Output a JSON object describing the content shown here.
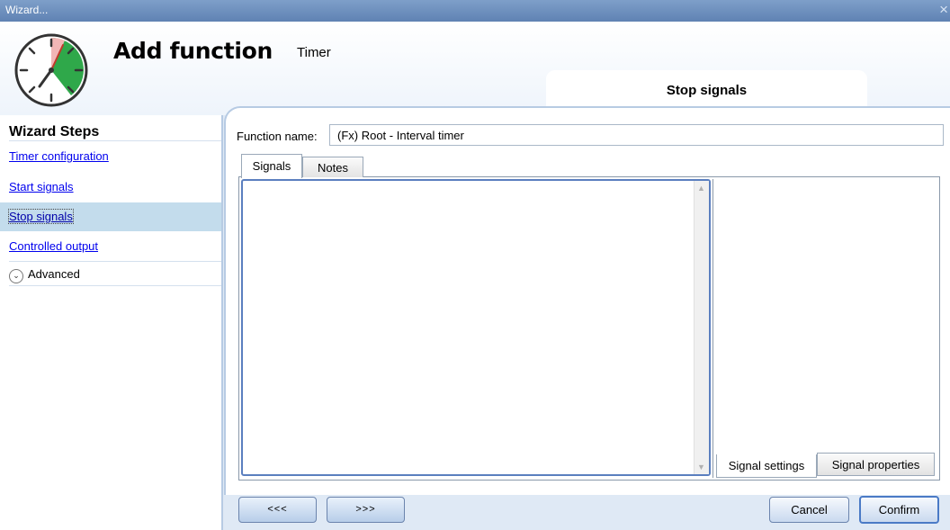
{
  "window": {
    "title": "Wizard...",
    "close_glyph": "×"
  },
  "header": {
    "title": "Add function",
    "subtitle": "Timer",
    "step_tab": "Stop signals"
  },
  "sidebar": {
    "title": "Wizard Steps",
    "items": [
      {
        "label": "Timer configuration",
        "selected": false
      },
      {
        "label": "Start signals",
        "selected": false
      },
      {
        "label": "Stop signals",
        "selected": true
      },
      {
        "label": "Controlled output",
        "selected": false
      }
    ],
    "advanced": {
      "label": "Advanced",
      "icon": "chevron-down-icon"
    }
  },
  "form": {
    "function_name_label": "Function name:",
    "function_name_value": "(Fx) Root - Interval timer",
    "tabs": [
      {
        "label": "Signals",
        "active": true
      },
      {
        "label": "Notes",
        "active": false
      }
    ],
    "bottom_tabs": [
      {
        "label": "Signal settings",
        "active": true
      },
      {
        "label": "Signal properties",
        "active": false
      }
    ]
  },
  "footer": {
    "back_label": "<<<",
    "next_label": ">>>",
    "cancel_label": "Cancel",
    "confirm_label": "Confirm"
  },
  "colors": {
    "titlebar": "#6b8cbf",
    "accent": "#4a7ac6",
    "selected_step": "#c3dcec",
    "clock_green": "#2fa84a"
  }
}
